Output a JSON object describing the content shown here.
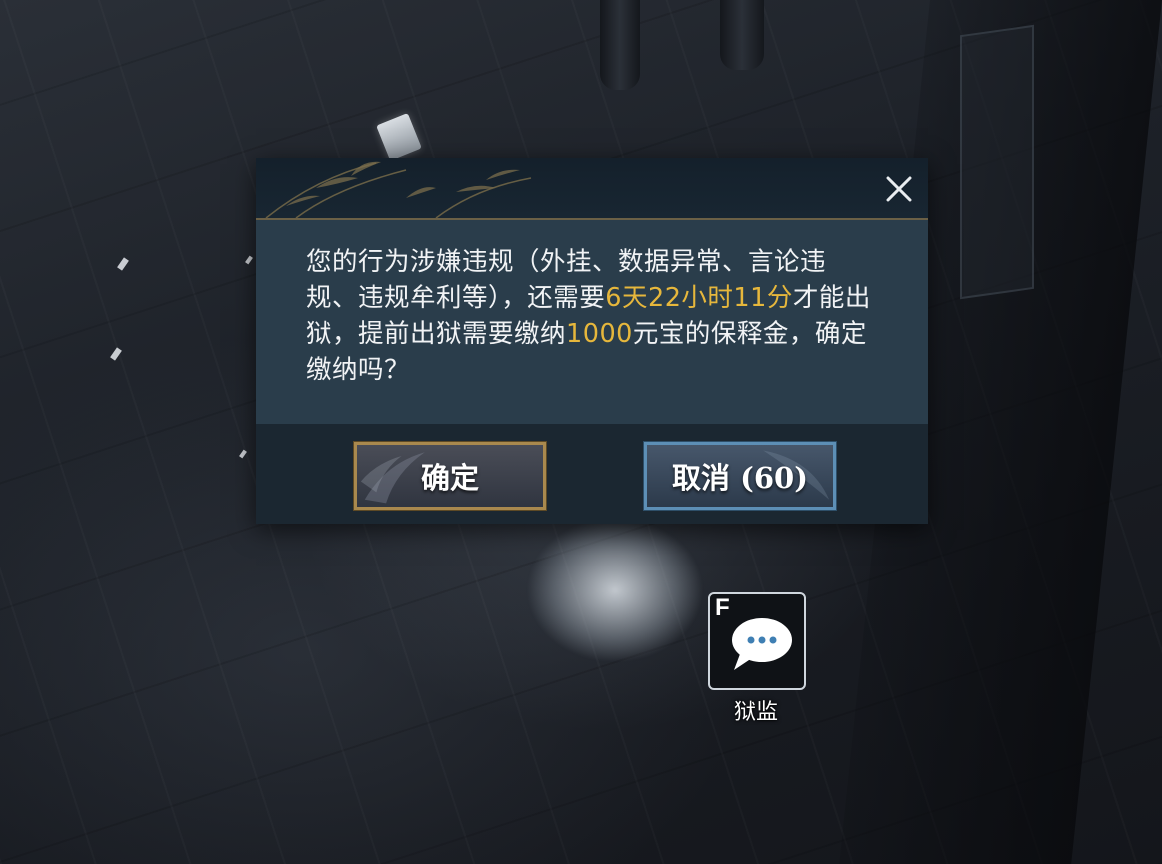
{
  "dialog": {
    "message_segments": [
      {
        "text": "您的行为涉嫌违规（外挂、数据异常、言论违规、违规牟利等），还需要",
        "highlight": false
      },
      {
        "text": "6天22小时11分",
        "highlight": true
      },
      {
        "text": "才能出狱，提前出狱需要缴纳",
        "highlight": false
      },
      {
        "text": "1000",
        "highlight": true
      },
      {
        "text": "元宝的保释金，确定缴纳吗？",
        "highlight": false
      }
    ],
    "confirm_label": "确定",
    "cancel_label": "取消 (60)",
    "close_icon": "close-icon"
  },
  "npc": {
    "hotkey": "F",
    "name": "狱监",
    "icon": "chat-bubble-icon"
  },
  "colors": {
    "highlight": "#e6b73c",
    "text": "#f1f3f5",
    "confirm_border": "#a9894e",
    "cancel_border": "#5d8fb6"
  }
}
